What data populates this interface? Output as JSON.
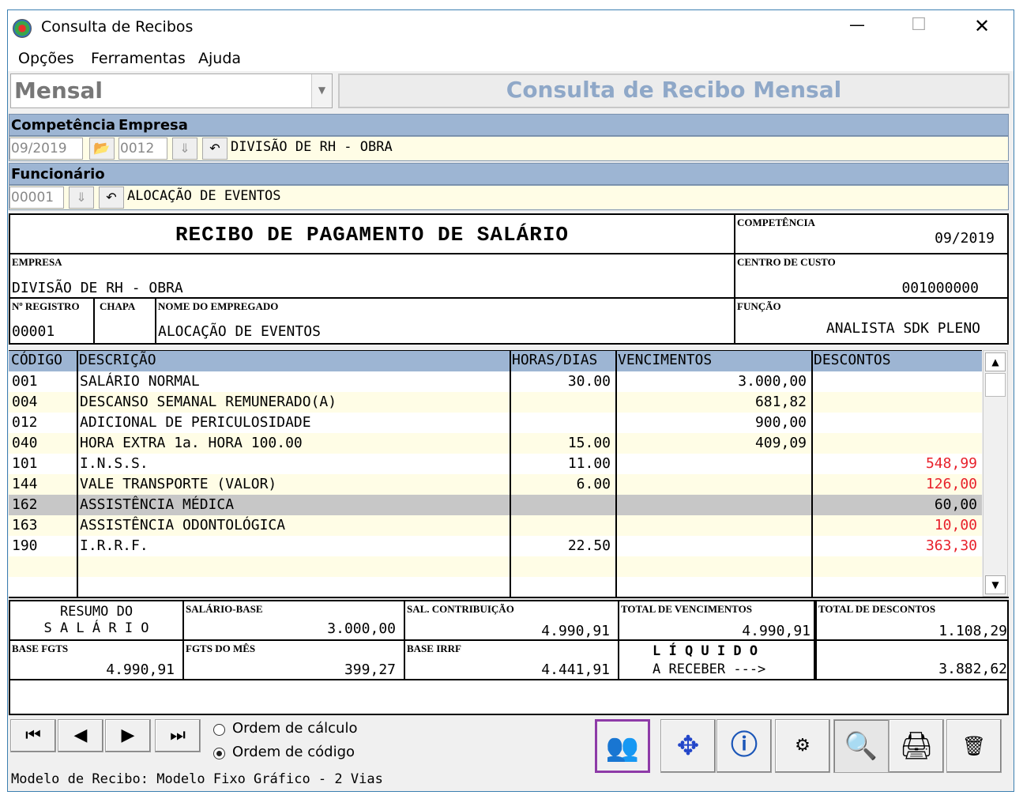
{
  "window": {
    "title": "Consulta de Recibos",
    "minimize": "—",
    "maximize": "☐",
    "close": "✕"
  },
  "menu": [
    "Opções",
    "Ferramentas",
    "Ajuda"
  ],
  "mode_select": {
    "value": "Mensal"
  },
  "header_title": "Consulta de Recibo Mensal",
  "filters": {
    "competencia_label": "Competência",
    "empresa_label": "Empresa",
    "competencia_value": "09/2019",
    "empresa_code": "0012",
    "empresa_name": "DIVISÃO DE RH - OBRA",
    "funcionario_label": "Funcionário",
    "funcionario_code": "00001",
    "funcionario_name": "ALOCAÇÃO DE EVENTOS"
  },
  "receipt": {
    "title": "RECIBO DE PAGAMENTO DE SALÁRIO",
    "competencia_label": "COMPETÊNCIA",
    "competencia": "09/2019",
    "empresa_label": "EMPRESA",
    "empresa": "DIVISÃO DE RH - OBRA",
    "centro_label": "CENTRO DE CUSTO",
    "centro": "001000000",
    "registro_label": "Nº REGISTRO",
    "registro": "00001",
    "chapa_label": "CHAPA",
    "nome_label": "NOME DO EMPREGADO",
    "nome": "ALOCAÇÃO DE EVENTOS",
    "funcao_label": "FUNÇÃO",
    "funcao": "ANALISTA SDK PLENO"
  },
  "table": {
    "columns": [
      "CÓDIGO",
      "DESCRIÇÃO",
      "HORAS/DIAS",
      "VENCIMENTOS",
      "DESCONTOS"
    ],
    "rows": [
      {
        "codigo": "001",
        "descricao": "SALÁRIO NORMAL",
        "horas": "30.00",
        "venc": "3.000,00",
        "desc": ""
      },
      {
        "codigo": "004",
        "descricao": "DESCANSO SEMANAL REMUNERADO(A)",
        "horas": "",
        "venc": "681,82",
        "desc": ""
      },
      {
        "codigo": "012",
        "descricao": "ADICIONAL DE PERICULOSIDADE",
        "horas": "",
        "venc": "900,00",
        "desc": ""
      },
      {
        "codigo": "040",
        "descricao": "HORA EXTRA 1a. HORA 100.00",
        "horas": "15.00",
        "venc": "409,09",
        "desc": ""
      },
      {
        "codigo": "101",
        "descricao": "I.N.S.S.",
        "horas": "11.00",
        "venc": "",
        "desc": "548,99"
      },
      {
        "codigo": "144",
        "descricao": "VALE TRANSPORTE (VALOR)",
        "horas": "6.00",
        "venc": "",
        "desc": "126,00"
      },
      {
        "codigo": "162",
        "descricao": "ASSISTÊNCIA MÉDICA",
        "horas": "",
        "venc": "",
        "desc": "60,00"
      },
      {
        "codigo": "163",
        "descricao": "ASSISTÊNCIA ODONTOLÓGICA",
        "horas": "",
        "venc": "",
        "desc": "10,00"
      },
      {
        "codigo": "190",
        "descricao": "I.R.R.F.",
        "horas": "22.50",
        "venc": "",
        "desc": "363,30"
      },
      {
        "codigo": "",
        "descricao": "",
        "horas": "",
        "venc": "",
        "desc": ""
      }
    ],
    "selected_row": 6
  },
  "summary": {
    "resumo_l1": "RESUMO DO",
    "resumo_l2": "S A L Á R I O",
    "salario_base_label": "SALÁRIO-BASE",
    "salario_base": "3.000,00",
    "sal_contrib_label": "SAL. CONTRIBUIÇÃO",
    "sal_contrib": "4.990,91",
    "total_venc_label": "TOTAL DE VENCIMENTOS",
    "total_venc": "4.990,91",
    "total_desc_label": "TOTAL DE DESCONTOS",
    "total_desc": "1.108,29",
    "base_fgts_label": "BASE FGTS",
    "base_fgts": "4.990,91",
    "fgts_mes_label": "FGTS DO MÊS",
    "fgts_mes": "399,27",
    "base_irrf_label": "BASE IRRF",
    "base_irrf": "4.441,91",
    "liquido_l1": "L Í Q U I D O",
    "liquido_l2": "A RECEBER --->",
    "liquido": "3.882,62"
  },
  "order": {
    "calculo": "Ordem de cálculo",
    "codigo": "Ordem de código",
    "selected": "codigo"
  },
  "footer": "Modelo de Recibo: Modelo Fixo Gráfico - 2 Vias"
}
